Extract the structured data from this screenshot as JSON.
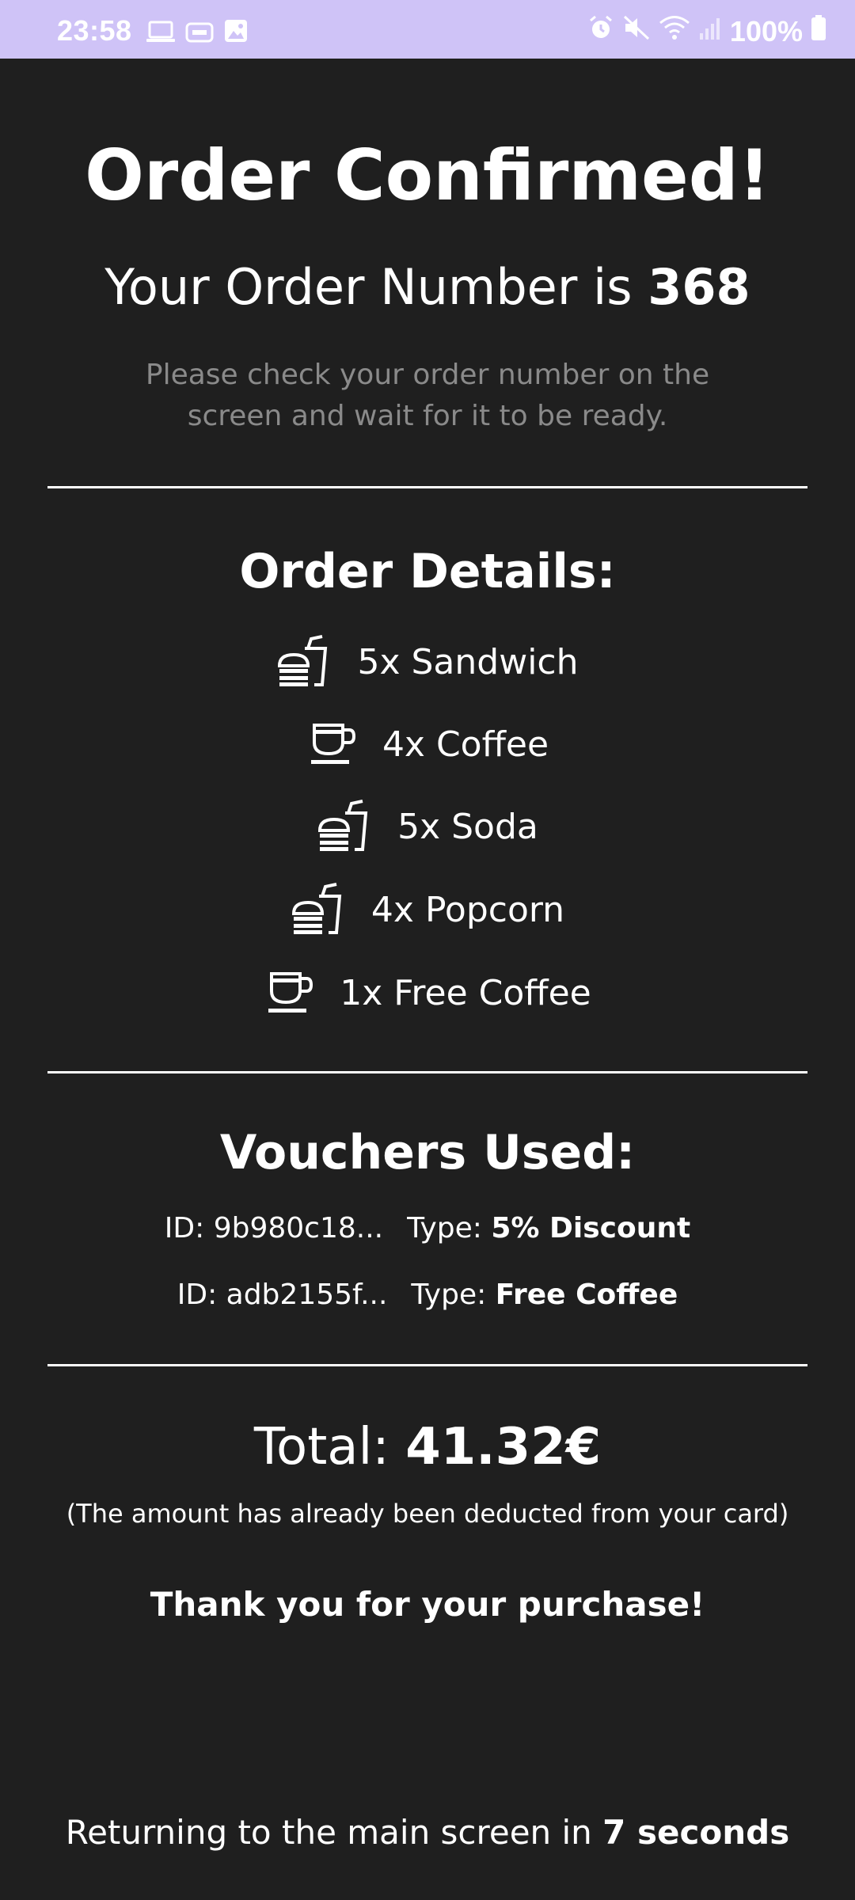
{
  "status_bar": {
    "time": "23:58",
    "battery": "100%",
    "left_icons": [
      "laptop-icon",
      "dex-icon",
      "image-icon"
    ],
    "right_icons": [
      "alarm-icon",
      "mute-icon",
      "wifi-icon",
      "signal-icon",
      "battery-icon"
    ]
  },
  "header": {
    "title": "Order Confirmed!",
    "order_prefix": "Your Order Number is ",
    "order_number": "368",
    "instructions": "Please check your order number on the screen and wait for it to be ready."
  },
  "order_details": {
    "title": "Order Details:",
    "items": [
      {
        "label": "5x Sandwich",
        "icon": "fastfood-icon"
      },
      {
        "label": "4x Coffee",
        "icon": "coffee-cup-icon"
      },
      {
        "label": "5x Soda",
        "icon": "fastfood-icon"
      },
      {
        "label": "4x Popcorn",
        "icon": "fastfood-icon"
      },
      {
        "label": "1x Free Coffee",
        "icon": "coffee-cup-icon"
      }
    ]
  },
  "vouchers": {
    "title": "Vouchers Used:",
    "type_prefix": "Type: ",
    "list": [
      {
        "id": "ID: 9b980c18...",
        "type": "5% Discount"
      },
      {
        "id": "ID: adb2155f...",
        "type": "Free Coffee"
      }
    ]
  },
  "summary": {
    "total_prefix": "Total: ",
    "total_value": "41.32€",
    "deducted_note": "(The amount has already been deducted from your card)",
    "thanks": "Thank you for your purchase!",
    "returning_prefix": "Returning to the main screen in ",
    "returning_value": "7 seconds"
  },
  "colors": {
    "background": "#1f1f1f",
    "status_bar": "#cfc3f7",
    "muted_text": "#8a8a8a",
    "text": "#ffffff"
  }
}
